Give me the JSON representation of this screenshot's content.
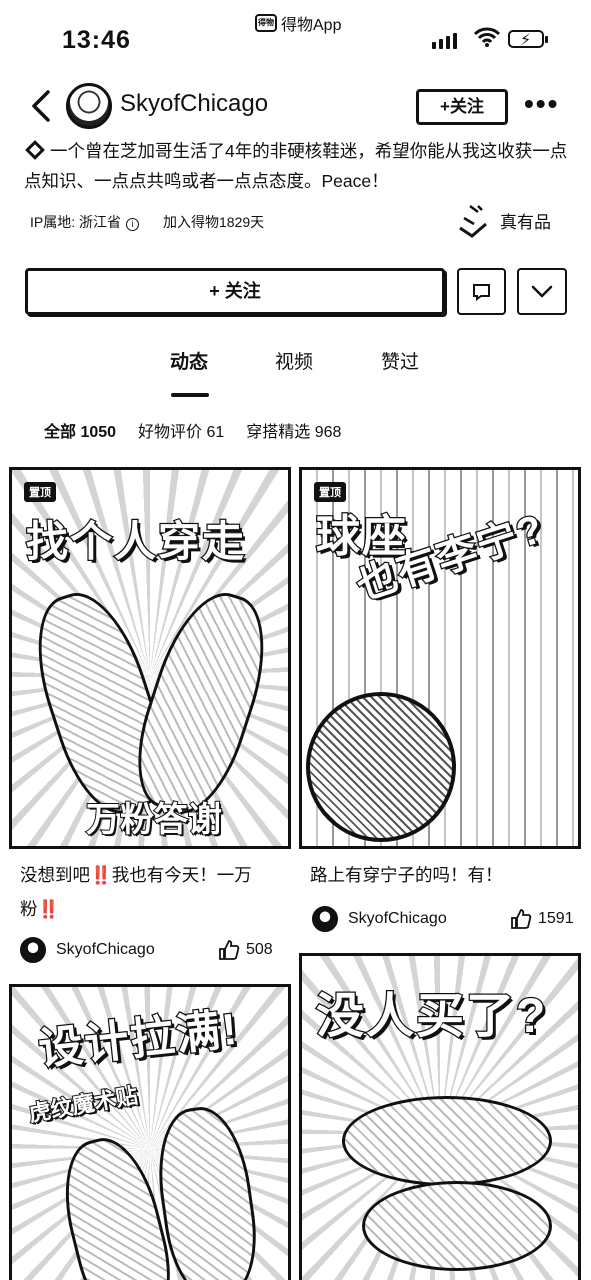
{
  "status_bar": {
    "time": "13:46",
    "app_name": "得物App",
    "app_logo_text": "得物"
  },
  "header": {
    "username": "SkyofChicago",
    "follow_small": "+关注"
  },
  "bio": "一个曾在芝加哥生活了4年的非硬核鞋迷，希望你能从我这收获一点点知识、一点点共鸣或者一点点态度。Peace！",
  "meta": {
    "ip": "IP属地: 浙江省",
    "joined": "加入得物1829天",
    "genuine": "真有品"
  },
  "actions": {
    "follow": "+ 关注"
  },
  "tabs": [
    {
      "label": "动态",
      "active": true
    },
    {
      "label": "视频",
      "active": false
    },
    {
      "label": "赞过",
      "active": false
    }
  ],
  "filters": [
    {
      "label": "全部 1050",
      "active": true
    },
    {
      "label": "好物评价 61",
      "active": false
    },
    {
      "label": "穿搭精选 968",
      "active": false
    }
  ],
  "posts": [
    {
      "pinned": "置顶",
      "headline": "找个人穿走",
      "caption": "万粉答谢",
      "title": "没想到吧‼️我也有今天！一万粉‼️",
      "author": "SkyofChicago",
      "likes": "508"
    },
    {
      "pinned": "置顶",
      "headline": "球座",
      "headline2": "也有李宁?",
      "title": "路上有穿宁子的吗！有！",
      "author": "SkyofChicago",
      "likes": "1591"
    },
    {
      "headline": "设计拉满!",
      "caption": "虎纹魔术贴"
    },
    {
      "headline": "没人买了?"
    }
  ]
}
